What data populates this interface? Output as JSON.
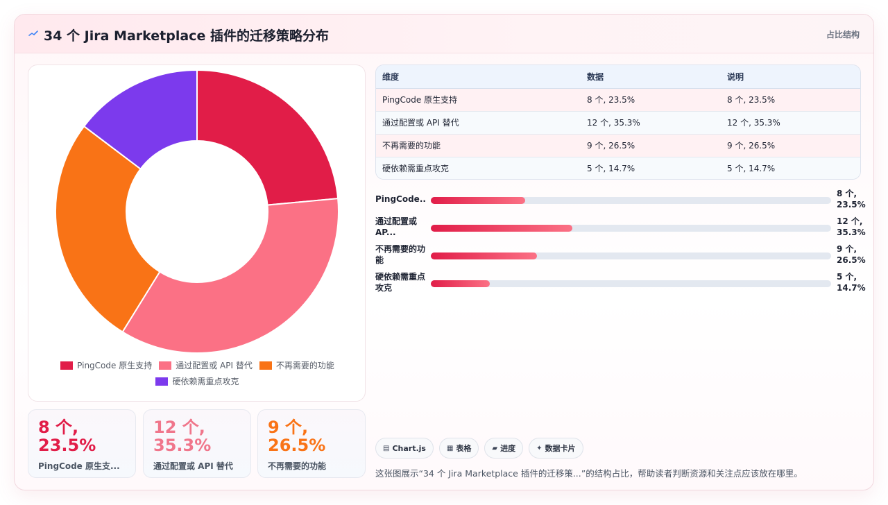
{
  "header": {
    "icon": "spark-icon",
    "title": "34 个 Jira Marketplace 插件的迁移策略分布",
    "tag": "占比结构"
  },
  "chart_data": {
    "type": "pie",
    "donut": true,
    "title": "",
    "categories": [
      "PingCode 原生支持",
      "通过配置或 API 替代",
      "不再需要的功能",
      "硬依赖需重点攻克"
    ],
    "values": [
      8,
      12,
      9,
      5
    ],
    "percents": [
      23.5,
      35.3,
      26.5,
      14.7
    ],
    "colors": [
      "#e11d48",
      "#fb7185",
      "#f97316",
      "#7c3aed"
    ],
    "legend_position": "bottom"
  },
  "legend": [
    {
      "label": "PingCode 原生支持",
      "color": "#e11d48"
    },
    {
      "label": "通过配置或 API 替代",
      "color": "#fb7185"
    },
    {
      "label": "不再需要的功能",
      "color": "#f97316"
    },
    {
      "label": "硬依赖需重点攻克",
      "color": "#7c3aed"
    }
  ],
  "stats": [
    {
      "value": "8 个, 23.5%",
      "label": "PingCode 原生支...",
      "color": "#e11d48"
    },
    {
      "value": "12 个, 35.3%",
      "label": "通过配置或 API 替代",
      "color": "#fb7185"
    },
    {
      "value": "9 个, 26.5%",
      "label": "不再需要的功能",
      "color": "#f97316"
    }
  ],
  "table": {
    "headers": [
      "维度",
      "数据",
      "说明"
    ],
    "rows": [
      [
        "PingCode 原生支持",
        "8 个, 23.5%",
        "8 个, 23.5%"
      ],
      [
        "通过配置或 API 替代",
        "12 个, 35.3%",
        "12 个, 35.3%"
      ],
      [
        "不再需要的功能",
        "9 个, 26.5%",
        "9 个, 26.5%"
      ],
      [
        "硬依赖需重点攻克",
        "5 个, 14.7%",
        "5 个, 14.7%"
      ]
    ]
  },
  "bars": [
    {
      "label": "PingCode...",
      "value": "8 个, 23.5%",
      "fraction": 0.2353
    },
    {
      "label": "通过配置或 AP...",
      "value": "12 个, 35.3%",
      "fraction": 0.3529
    },
    {
      "label": "不再需要的功能",
      "value": "9 个, 26.5%",
      "fraction": 0.2647
    },
    {
      "label": "硬依赖需重点攻克",
      "value": "5 个, 14.7%",
      "fraction": 0.1471
    }
  ],
  "chips": [
    {
      "icon": "chart-icon",
      "glyph": "▤",
      "label": "Chart.js"
    },
    {
      "icon": "table-icon",
      "glyph": "▦",
      "label": "表格"
    },
    {
      "icon": "progress-icon",
      "glyph": "▰",
      "label": "进度"
    },
    {
      "icon": "card-icon",
      "glyph": "✦",
      "label": "数据卡片"
    }
  ],
  "footnote": "这张图展示“34 个 Jira Marketplace 插件的迁移策...”的结构占比，帮助读者判断资源和关注点应该放在哪里。"
}
